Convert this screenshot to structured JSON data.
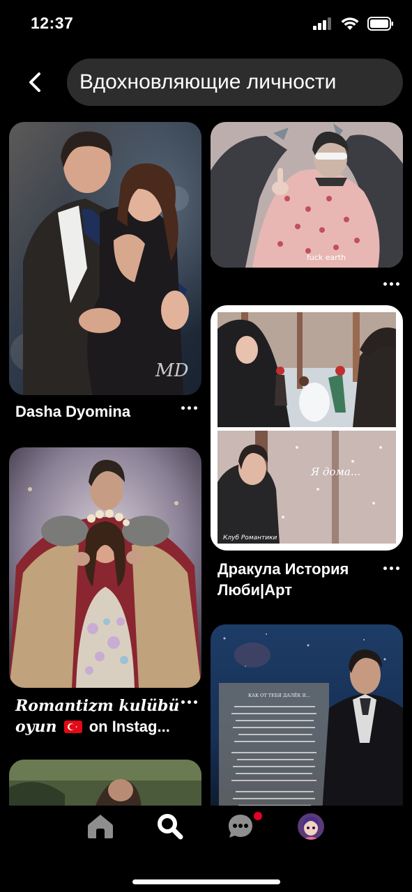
{
  "status": {
    "time": "12:37"
  },
  "search": {
    "query": "Вдохновляющие личности"
  },
  "pins": [
    {
      "id": 1,
      "title": "Dasha Dyomina",
      "signature": "MD"
    },
    {
      "id": 2,
      "caption": "fuck earth"
    },
    {
      "id": 3,
      "title_lines": [
        "Дракула История",
        "Люби|Арт"
      ],
      "panel_caption": "Я дома...",
      "watermark": "Клуб Романтики"
    },
    {
      "id": 4,
      "title_line1": "Romantizm kulübü",
      "title_line2_italic": "oyun",
      "flag": "🇹🇷",
      "title_line2_rest": "on Instag..."
    },
    {
      "id": 5,
      "poem_title": "КАК ОТ ТЕБЯ ДАЛЁК Я..."
    }
  ],
  "nav": {
    "items": [
      "home-icon",
      "search-icon",
      "messages-icon",
      "profile-avatar"
    ],
    "notification_color": "#e60023"
  }
}
